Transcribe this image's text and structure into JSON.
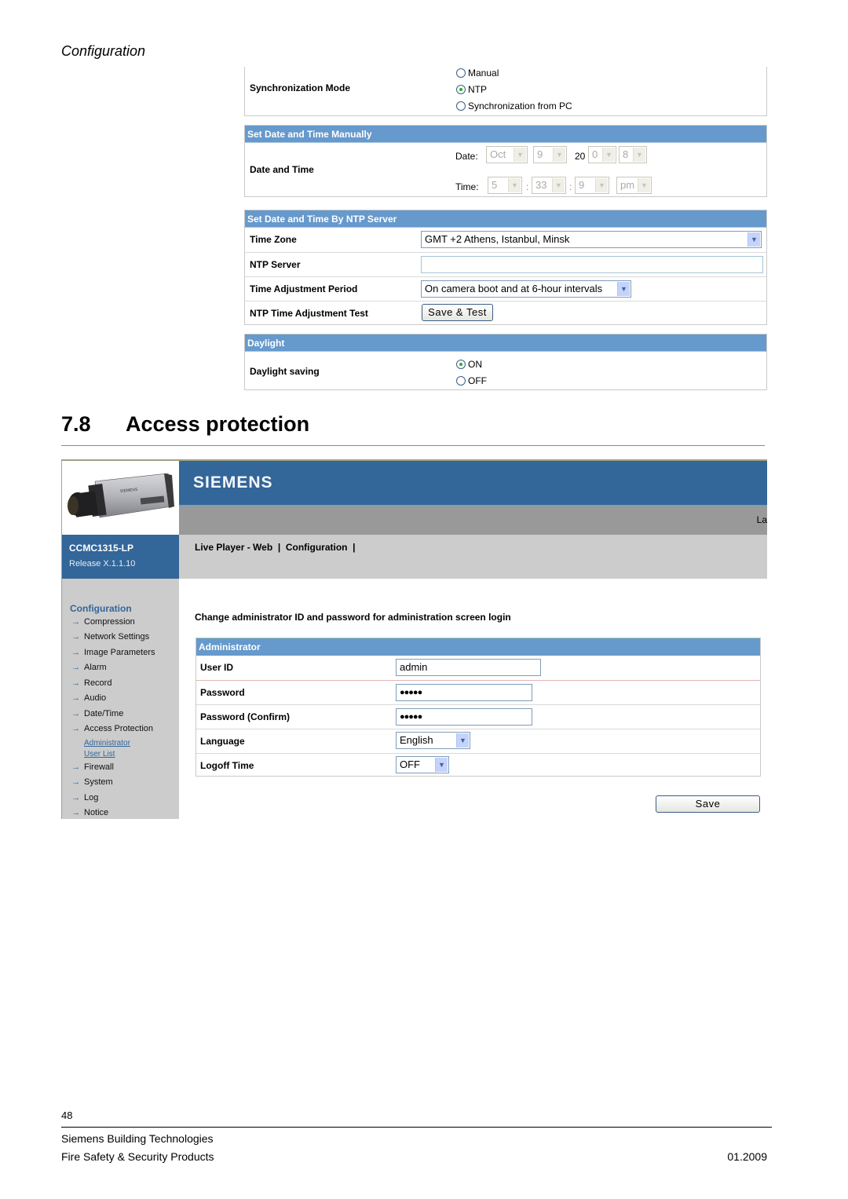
{
  "page": {
    "running_head": "Configuration",
    "section_number": "7.8",
    "section_title": "Access protection",
    "page_number": "48",
    "footer_company": "Siemens Building Technologies",
    "footer_division": "Fire Safety & Security Products",
    "footer_date": "01.2009"
  },
  "sync": {
    "label": "Synchronization Mode",
    "options": [
      "Manual",
      "NTP",
      "Synchronization from PC"
    ],
    "selected": "NTP"
  },
  "manual": {
    "header": "Set Date and Time Manually",
    "label": "Date and Time",
    "date_label": "Date:",
    "month": "Oct",
    "day": "9",
    "year_prefix": "20",
    "year_tens": "0",
    "year_ones": "8",
    "time_label": "Time:",
    "hour": "5",
    "minute": "33",
    "second": "9",
    "ampm": "pm",
    "sep": ":"
  },
  "ntp": {
    "header": "Set Date and Time By NTP Server",
    "time_zone_label": "Time Zone",
    "time_zone_value": "GMT +2 Athens, Istanbul, Minsk",
    "server_label": "NTP Server",
    "server_value": "",
    "period_label": "Time Adjustment Period",
    "period_value": "On camera boot and at 6-hour intervals",
    "test_label": "NTP Time Adjustment Test",
    "test_button": "Save & Test"
  },
  "daylight": {
    "header": "Daylight",
    "label": "Daylight saving",
    "options": [
      "ON",
      "OFF"
    ],
    "selected": "ON"
  },
  "web": {
    "brand": "SIEMENS",
    "model": "CCMC1315-LP",
    "release": "Release X.1.1.10",
    "lang_cut": "La",
    "nav": "Live Player - Web  |  Configuration  |",
    "sidebar_title": "Configuration",
    "arrow": "→",
    "sidebar_items": [
      "Compression",
      "Network Settings",
      "Image Parameters",
      "Alarm",
      "Record",
      "Audio",
      "Date/Time",
      "Access Protection"
    ],
    "sidebar_subitems": [
      "Administrator",
      "User List"
    ],
    "sidebar_items_after": [
      "Firewall",
      "System",
      "Log",
      "Notice"
    ],
    "description": "Change administrator ID and password for administration screen login",
    "admin_header": "Administrator",
    "user_id_label": "User ID",
    "user_id_value": "admin",
    "password_label": "Password",
    "password_value": "●●●●●",
    "password_confirm_label": "Password (Confirm)",
    "password_confirm_value": "●●●●●",
    "language_label": "Language",
    "language_value": "English",
    "logoff_label": "Logoff Time",
    "logoff_value": "OFF",
    "save_button": "Save",
    "dropdown_arrow": "▼"
  },
  "colors": {
    "header_blue": "#6699cc",
    "brand_blue": "#336699",
    "nav_grey": "#cccccc",
    "bar_grey": "#999999"
  }
}
